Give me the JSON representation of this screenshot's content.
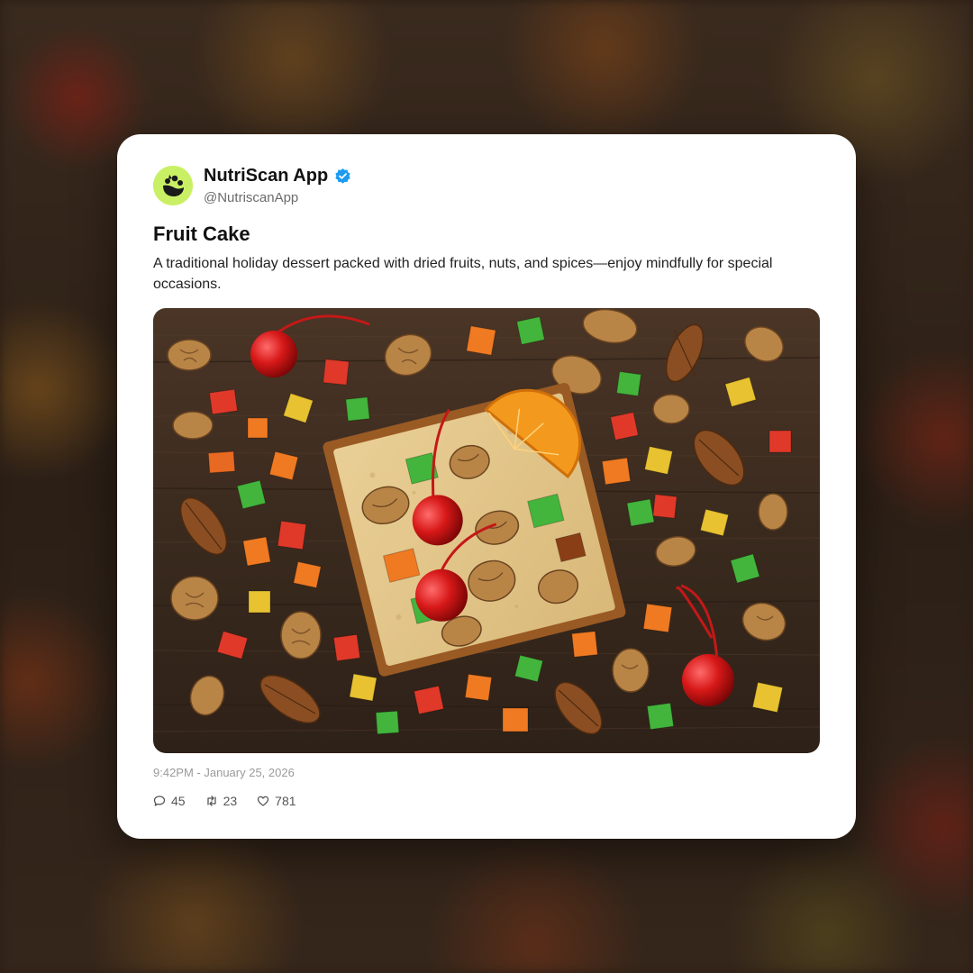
{
  "post": {
    "author_name": "NutriScan App",
    "author_handle": "@NutriscanApp",
    "title": "Fruit Cake",
    "description": "A traditional holiday dessert packed with dried fruits, nuts, and spices—enjoy mindfully for special occasions.",
    "timestamp": "9:42PM - January 25, 2026"
  },
  "stats": {
    "replies": "45",
    "retweets": "23",
    "likes": "781"
  },
  "icons": {
    "avatar": "nutriscan-logo-icon",
    "verified": "verified-badge-icon",
    "reply": "speech-bubble-icon",
    "retweet": "retweet-arrows-icon",
    "like": "heart-icon"
  },
  "colors": {
    "avatar_bg": "#c9f065",
    "verified": "#1d9bf0",
    "card_bg": "#ffffff",
    "wood": "#3b2a1e"
  }
}
